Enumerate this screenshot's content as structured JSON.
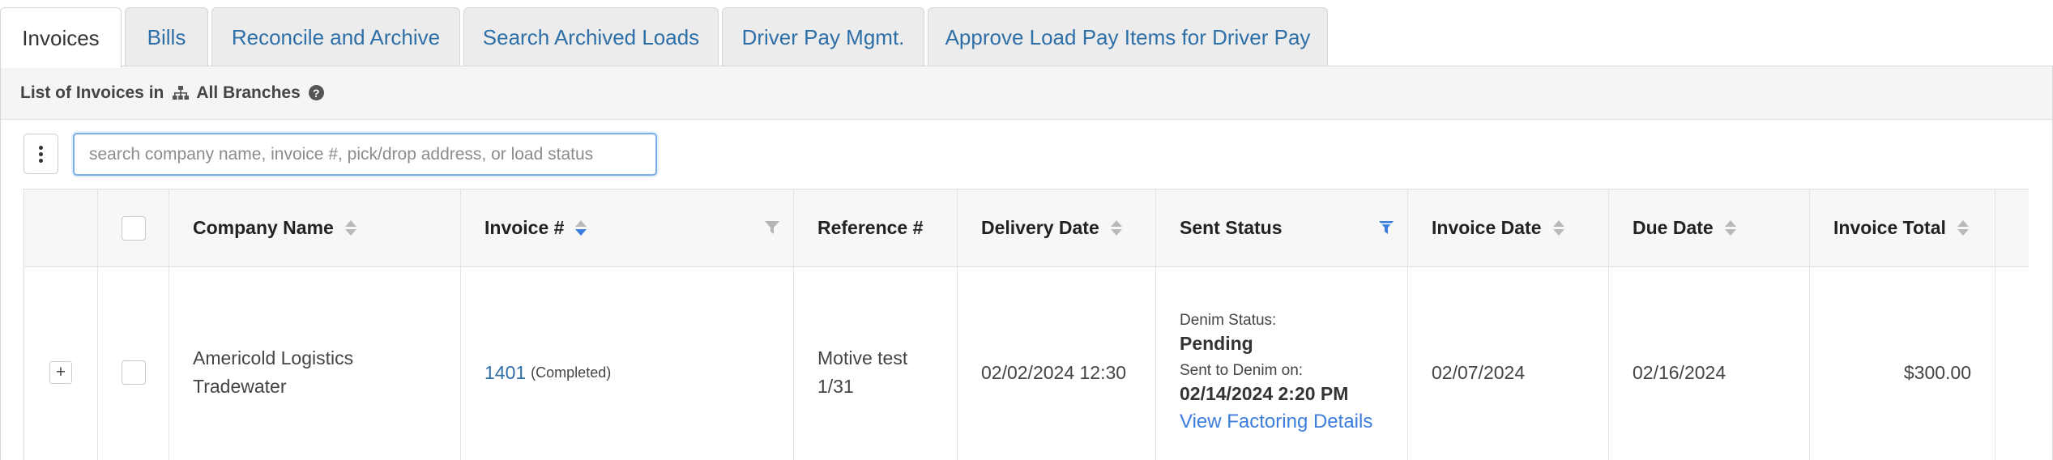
{
  "tabs": [
    {
      "label": "Invoices",
      "active": true
    },
    {
      "label": "Bills"
    },
    {
      "label": "Reconcile and Archive"
    },
    {
      "label": "Search Archived Loads"
    },
    {
      "label": "Driver Pay Mgmt."
    },
    {
      "label": "Approve Load Pay Items for Driver Pay"
    }
  ],
  "panel": {
    "title": "List of Invoices in",
    "branch": "All Branches",
    "help_icon": "?"
  },
  "toolbar": {
    "menu_icon": "kebab-vertical-icon",
    "search_placeholder": "search company name, invoice #, pick/drop address, or load status",
    "search_value": ""
  },
  "table": {
    "columns": {
      "company": "Company Name",
      "invoice": "Invoice #",
      "reference": "Reference #",
      "delivery": "Delivery Date",
      "sent": "Sent Status",
      "invoice_date": "Invoice Date",
      "due": "Due Date",
      "total": "Invoice Total"
    },
    "sort_active": "invoice",
    "filter_active": "sent",
    "rows": [
      {
        "expand": "+",
        "company_line1": "Americold Logistics",
        "company_line2": "Tradewater",
        "invoice_no": "1401",
        "invoice_status": "(Completed)",
        "reference_line1": "Motive test",
        "reference_line2": "1/31",
        "delivery_date": "02/02/2024 12:30",
        "sent_status": {
          "label1": "Denim Status:",
          "value1": "Pending",
          "label2": "Sent to Denim on:",
          "value2": "02/14/2024 2:20 PM",
          "link": "View Factoring Details"
        },
        "invoice_date": "02/07/2024",
        "due_date": "02/16/2024",
        "invoice_total": "$300.00"
      }
    ]
  },
  "colors": {
    "link": "#2f6fa8",
    "accent": "#3b7ddd",
    "tab_bg": "#ececec",
    "header_bg": "#f5f5f5"
  }
}
